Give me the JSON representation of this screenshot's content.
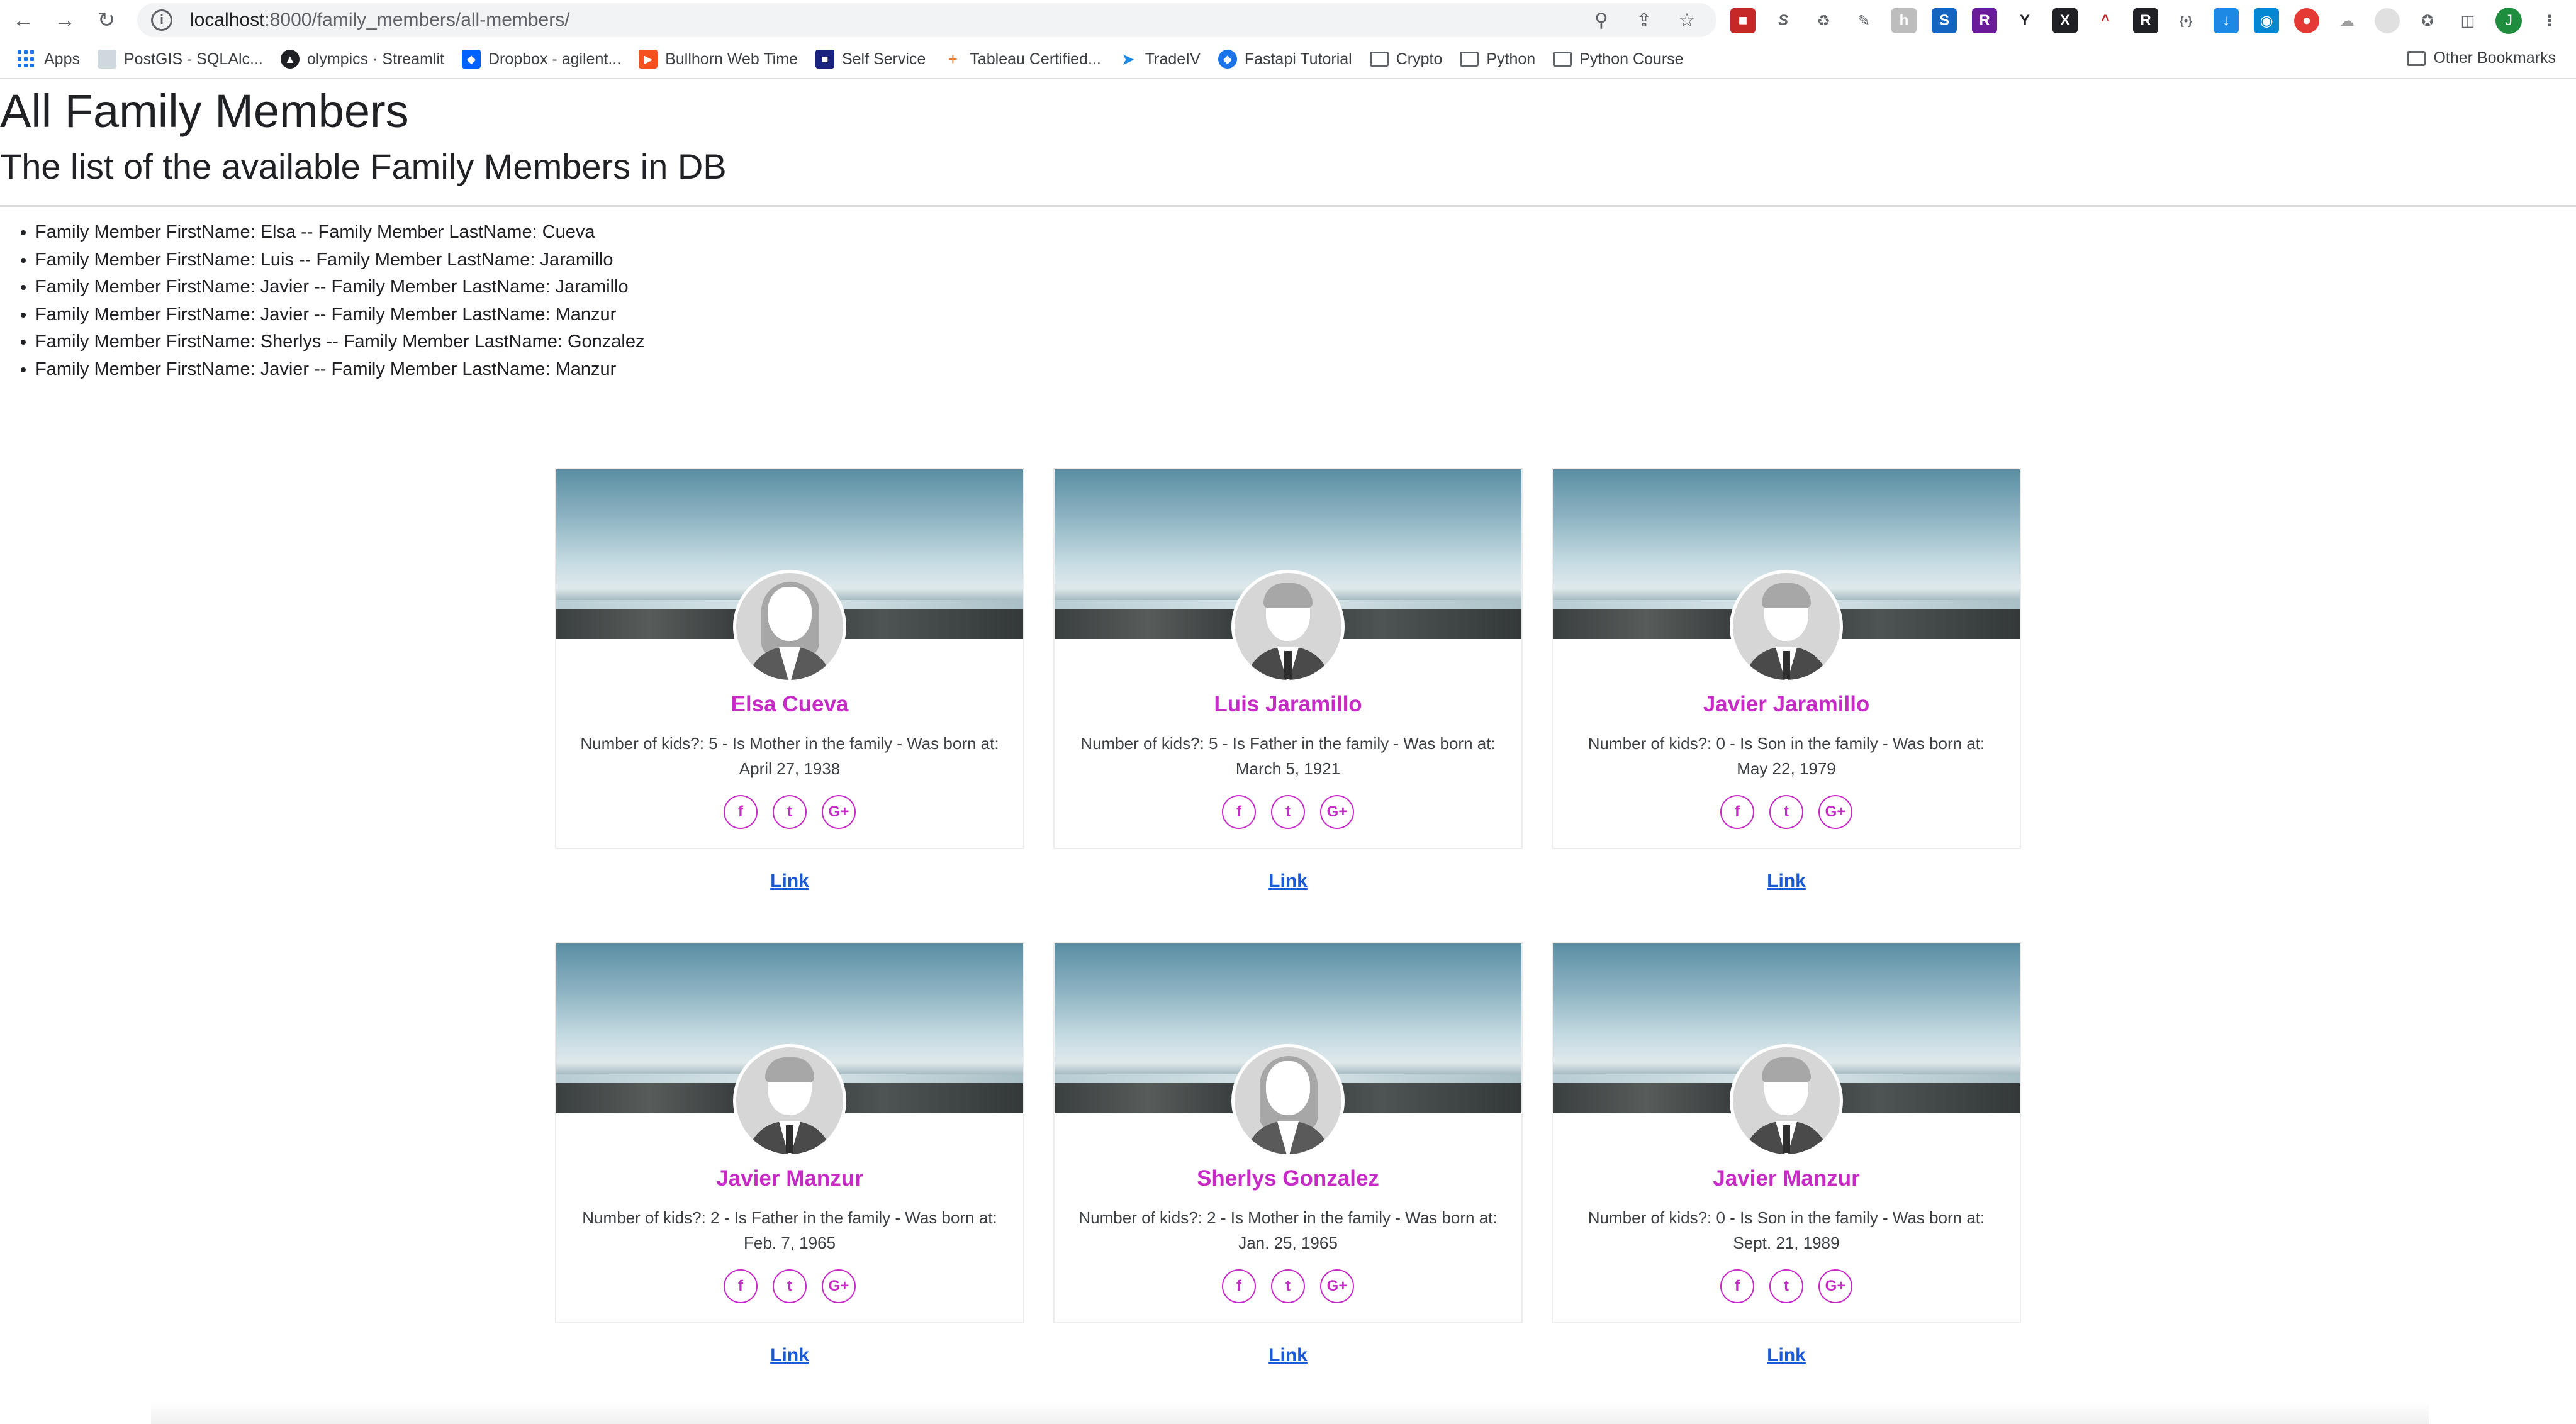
{
  "browser": {
    "url_host": "localhost",
    "url_path": ":8000/family_members/all-members/",
    "bookmarks": [
      {
        "label": "Apps",
        "icon": "apps-grid-icon"
      },
      {
        "label": "PostGIS - SQLAlc...",
        "icon": "page-icon"
      },
      {
        "label": "olympics · Streamlit",
        "icon": "streamlit-icon"
      },
      {
        "label": "Dropbox - agilent...",
        "icon": "dropbox-icon"
      },
      {
        "label": "Bullhorn Web Time",
        "icon": "bullhorn-icon"
      },
      {
        "label": "Self Service",
        "icon": "self-service-icon"
      },
      {
        "label": "Tableau Certified...",
        "icon": "tableau-icon"
      },
      {
        "label": "TradeIV",
        "icon": "tradeiv-icon"
      },
      {
        "label": "Fastapi Tutorial",
        "icon": "fastapi-icon"
      },
      {
        "label": "Crypto",
        "icon": "folder-icon"
      },
      {
        "label": "Python",
        "icon": "folder-icon"
      },
      {
        "label": "Python Course",
        "icon": "folder-icon"
      }
    ],
    "other_bookmarks": "Other Bookmarks",
    "profile_initial": "J"
  },
  "page": {
    "title": "All Family Members",
    "subtitle": "The list of the available Family Members in DB",
    "list": [
      "Family Member FirstName: Elsa -- Family Member LastName: Cueva",
      "Family Member FirstName: Luis -- Family Member LastName: Jaramillo",
      "Family Member FirstName: Javier -- Family Member LastName: Jaramillo",
      "Family Member FirstName: Javier -- Family Member LastName: Manzur",
      "Family Member FirstName: Sherlys -- Family Member LastName: Gonzalez",
      "Family Member FirstName: Javier -- Family Member LastName: Manzur"
    ],
    "cards": [
      {
        "name": "Elsa Cueva",
        "desc": "Number of kids?: 5 - Is Mother in the family - Was born at: April 27, 1938",
        "link": "Link",
        "avatar": "female"
      },
      {
        "name": "Luis Jaramillo",
        "desc": "Number of kids?: 5 - Is Father in the family - Was born at: March 5, 1921",
        "link": "Link",
        "avatar": "male"
      },
      {
        "name": "Javier Jaramillo",
        "desc": "Number of kids?: 0 - Is Son in the family - Was born at: May 22, 1979",
        "link": "Link",
        "avatar": "male"
      },
      {
        "name": "Javier Manzur",
        "desc": "Number of kids?: 2 - Is Father in the family - Was born at: Feb. 7, 1965",
        "link": "Link",
        "avatar": "male"
      },
      {
        "name": "Sherlys Gonzalez",
        "desc": "Number of kids?: 2 - Is Mother in the family - Was born at: Jan. 25, 1965",
        "link": "Link",
        "avatar": "female"
      },
      {
        "name": "Javier Manzur",
        "desc": "Number of kids?: 0 - Is Son in the family - Was born at: Sept. 21, 1989",
        "link": "Link",
        "avatar": "male"
      }
    ],
    "social_icons": [
      "facebook-icon",
      "twitter-icon",
      "google-plus-icon"
    ],
    "accent_color": "#c62bc6",
    "link_color": "#1a5ad6"
  }
}
